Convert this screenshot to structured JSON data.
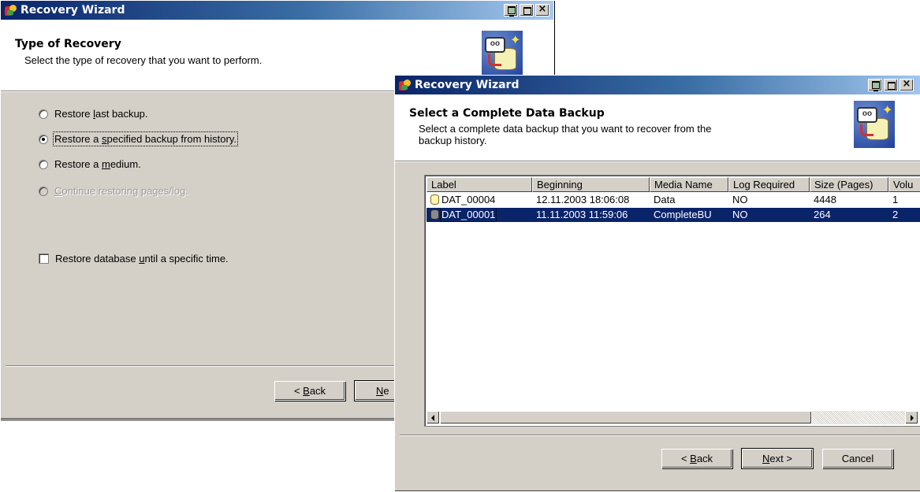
{
  "back_window": {
    "title": "Recovery Wizard",
    "header_title": "Type of Recovery",
    "header_subtitle": "Select the type of recovery that you want to perform.",
    "options": [
      {
        "pre": "Restore ",
        "key": "l",
        "post": "ast backup.",
        "checked": false,
        "disabled": false
      },
      {
        "pre": "Restore a ",
        "key": "s",
        "post": "pecified backup from history.",
        "checked": true,
        "disabled": false
      },
      {
        "pre": "Restore a ",
        "key": "m",
        "post": "edium.",
        "checked": false,
        "disabled": false
      },
      {
        "pre": "",
        "key": "C",
        "post": "ontinue restoring pages/log.",
        "checked": false,
        "disabled": true
      }
    ],
    "checkbox": {
      "pre": "Restore database ",
      "key": "u",
      "post": "ntil a specific time.",
      "checked": false
    },
    "buttons": {
      "back": {
        "pre": "< ",
        "key": "B",
        "post": "ack"
      },
      "next_partial": {
        "pre": "",
        "key": "N",
        "post": "e"
      }
    }
  },
  "front_window": {
    "title": "Recovery Wizard",
    "header_title": "Select a Complete Data Backup",
    "header_subtitle_line1": "Select a complete data backup that you want to recover from the",
    "header_subtitle_line2": "backup history.",
    "table": {
      "columns": [
        "Label",
        "Beginning",
        "Media Name",
        "Log Required",
        "Size (Pages)",
        "Volu"
      ],
      "rows": [
        {
          "icon": "database-data-icon",
          "cells": [
            "DAT_00004",
            "12.11.2003 18:06:08",
            "Data",
            "NO",
            "4448",
            "1"
          ],
          "selected": false
        },
        {
          "icon": "database-complete-icon",
          "cells": [
            "DAT_00001",
            "11.11.2003 11:59:06",
            "CompleteBU",
            "NO",
            "264",
            "2"
          ],
          "selected": true
        }
      ]
    },
    "buttons": {
      "back": {
        "pre": "< ",
        "key": "B",
        "post": "ack"
      },
      "next": {
        "pre": "",
        "key": "N",
        "post": "ext >"
      },
      "cancel": "Cancel"
    }
  },
  "icons": {
    "app": "recovery-wizard-app-icon",
    "wizard": "database-recovery-wizard-icon",
    "wizard_badge_text": "oo"
  },
  "colors": {
    "titlebar_start": "#0a246a",
    "titlebar_end": "#a6caf0",
    "selection": "#0a246a",
    "dialog_face": "#d4d0c8"
  }
}
